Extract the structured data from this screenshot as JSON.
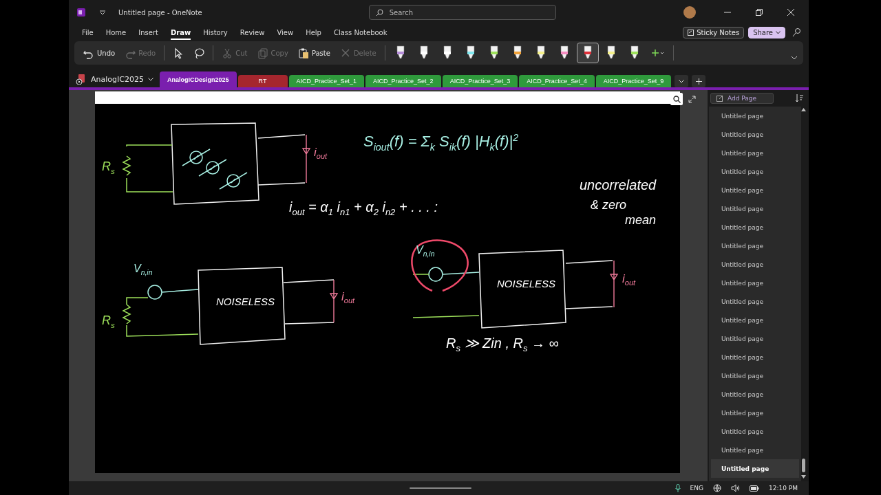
{
  "window": {
    "title": "Untitled page - OneNote"
  },
  "search": {
    "placeholder": "Search"
  },
  "menu": [
    {
      "label": "File",
      "selected": false
    },
    {
      "label": "Home",
      "selected": false
    },
    {
      "label": "Insert",
      "selected": false
    },
    {
      "label": "Draw",
      "selected": true
    },
    {
      "label": "History",
      "selected": false
    },
    {
      "label": "Review",
      "selected": false
    },
    {
      "label": "View",
      "selected": false
    },
    {
      "label": "Help",
      "selected": false
    },
    {
      "label": "Class Notebook",
      "selected": false
    }
  ],
  "header_buttons": [
    {
      "label": "Sticky Notes",
      "kind": "plain"
    },
    {
      "label": "Share",
      "kind": "accent"
    }
  ],
  "toolbar": [
    {
      "kind": "undo",
      "label": "Undo",
      "disabled": false
    },
    {
      "kind": "redo",
      "label": "Redo",
      "disabled": true
    },
    {
      "kind": "select",
      "disabled": false
    },
    {
      "kind": "lasso",
      "disabled": false
    },
    {
      "kind": "cut",
      "label": "Cut",
      "disabled": true
    },
    {
      "kind": "copy",
      "label": "Copy",
      "disabled": true
    },
    {
      "kind": "paste",
      "label": "Paste",
      "disabled": false
    },
    {
      "kind": "delete",
      "label": "Delete",
      "disabled": true
    }
  ],
  "pens": [
    {
      "color": "#b48cd8",
      "selected": false
    },
    {
      "color": "#ffffff",
      "selected": false
    },
    {
      "color": "#ffffff",
      "selected": false
    },
    {
      "color": "#7fe8f0",
      "selected": false
    },
    {
      "color": "#9de05a",
      "selected": false
    },
    {
      "color": "#f0a23a",
      "selected": false
    },
    {
      "color": "#f4f08a",
      "selected": false
    },
    {
      "color": "#f48cc0",
      "selected": false
    },
    {
      "color": "#e0303a",
      "selected": true
    },
    {
      "color": "#f4f08a",
      "selected": false
    },
    {
      "color": "#9de05a",
      "selected": false
    }
  ],
  "notebook": {
    "name": "AnalogIC2025"
  },
  "sections": [
    {
      "label": "AnalogICDesign2025",
      "color": "#7a1fae",
      "selected": true
    },
    {
      "label": "RT",
      "color": "#a5262e",
      "selected": false
    },
    {
      "label": "AICD_Practice_Set_1",
      "color": "#2f9a3c",
      "selected": false
    },
    {
      "label": "AICD_Practice_Set_2",
      "color": "#2f9a3c",
      "selected": false
    },
    {
      "label": "AICD_Practice_Set_3",
      "color": "#2f9a3c",
      "selected": false
    },
    {
      "label": "AICD_Practice_Set_4",
      "color": "#2f9a3c",
      "selected": false
    },
    {
      "label": "AICD_Practice_Set_9",
      "color": "#2f9a3c",
      "selected": false
    }
  ],
  "ink": [
    {
      "text": "R$_{s}$",
      "color": "#9de05a"
    },
    {
      "text": "i$_{out}$",
      "color": "#f07a9a"
    },
    {
      "text": "S$_{iout}$(f) = Σ$_{k}$ S$_{ik}$(f) |H$_{k}$(f)|$^{2}$",
      "color": "#a8f0e4"
    },
    {
      "text": "i$_{out}$ = α$_{1}$ i$_{n1}$ + α$_{2}$ i$_{n2}$ + . . .   :",
      "color": "#ffffff"
    },
    {
      "text": "uncorrelated",
      "color": "#ffffff"
    },
    {
      "text": "& zero",
      "color": "#ffffff"
    },
    {
      "text": "mean",
      "color": "#ffffff"
    },
    {
      "text": "V$_{n,in}$",
      "color": "#a8f0e4"
    },
    {
      "text": "R$_{s}$",
      "color": "#9de05a"
    },
    {
      "text": "NOISELESS",
      "color": "#ffffff"
    },
    {
      "text": "i$_{out}$",
      "color": "#f07a9a"
    },
    {
      "text": "V$_{n,in}$",
      "color": "#a8f0e4"
    },
    {
      "text": "NOISELESS",
      "color": "#ffffff"
    },
    {
      "text": "i$_{out}$",
      "color": "#f07a9a"
    },
    {
      "text": "R$_{s}$ ≫ Zin , R$_{s}$ → ∞",
      "color": "#ffffff"
    }
  ],
  "pages_panel": {
    "add_label": "Add Page"
  },
  "pages": [
    {
      "title": "Untitled page",
      "selected": false
    },
    {
      "title": "Untitled page",
      "selected": false
    },
    {
      "title": "Untitled page",
      "selected": false
    },
    {
      "title": "Untitled page",
      "selected": false
    },
    {
      "title": "Untitled page",
      "selected": false
    },
    {
      "title": "Untitled page",
      "selected": false
    },
    {
      "title": "Untitled page",
      "selected": false
    },
    {
      "title": "Untitled page",
      "selected": false
    },
    {
      "title": "Untitled page",
      "selected": false
    },
    {
      "title": "Untitled page",
      "selected": false
    },
    {
      "title": "Untitled page",
      "selected": false
    },
    {
      "title": "Untitled page",
      "selected": false
    },
    {
      "title": "Untitled page",
      "selected": false
    },
    {
      "title": "Untitled page",
      "selected": false
    },
    {
      "title": "Untitled page",
      "selected": false
    },
    {
      "title": "Untitled page",
      "selected": false
    },
    {
      "title": "Untitled page",
      "selected": false
    },
    {
      "title": "Untitled page",
      "selected": false
    },
    {
      "title": "Untitled page",
      "selected": false
    },
    {
      "title": "Untitled page",
      "selected": true
    }
  ],
  "taskbar": {
    "language": "ENG",
    "time": "12:10 PM"
  }
}
